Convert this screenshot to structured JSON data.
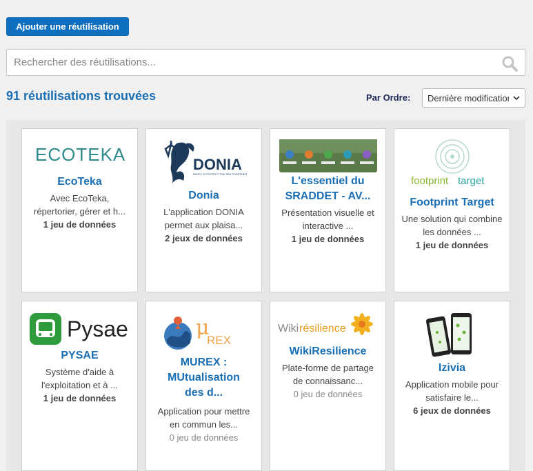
{
  "toolbar": {
    "add_label": "Ajouter une réutilisation"
  },
  "search": {
    "placeholder": "Rechercher des réutilisations..."
  },
  "results": {
    "count_text": "91 réutilisations trouvées"
  },
  "sort": {
    "label": "Par Ordre:",
    "selected": "Dernière modification"
  },
  "logos": {
    "ecoteka": "ECOTEKA",
    "donia": "DONIA",
    "donia_tagline": "ENJOY & PROTECT THE SEA TOGETHER",
    "pysae": "Pysae",
    "murex": "REX",
    "wiki_a": "Wiki",
    "wiki_b": "résilience",
    "footprint_a": "footprint",
    "footprint_b": "target"
  },
  "cards": [
    {
      "title": "EcoTeka",
      "desc": "Avec EcoTeka, répertorier, gérer et h...",
      "datasets": "1 jeu de données"
    },
    {
      "title": "Donia",
      "desc": "L'application DONIA permet aux plaisa...",
      "datasets": "2 jeux de données"
    },
    {
      "title": "L'essentiel du SRADDET - AV...",
      "desc": "Présentation visuelle et interactive ...",
      "datasets": "1 jeu de données"
    },
    {
      "title": "Footprint Target",
      "desc": "Une solution qui combine les données ...",
      "datasets": "1 jeu de données"
    },
    {
      "title": "PYSAE",
      "desc": "Système d'aide à l'exploitation et à ...",
      "datasets": "1 jeu de données"
    },
    {
      "title": "MUREX : MUtualisation des d...",
      "desc": "Application pour mettre en commun les...",
      "datasets": "0 jeu de données"
    },
    {
      "title": "WikiResilience",
      "desc": "Plate-forme de partage de connaissanc...",
      "datasets": "0 jeu de données"
    },
    {
      "title": "Izivia",
      "desc": "Application mobile pour satisfaire le...",
      "datasets": "6 jeux de données"
    }
  ]
}
